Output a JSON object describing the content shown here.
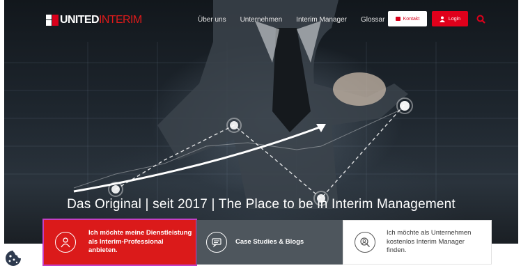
{
  "brand": {
    "logo_part1": "UNITED",
    "logo_part2": "INTERIM",
    "accent": "#d9001b"
  },
  "nav": {
    "items": [
      {
        "label": "Über uns"
      },
      {
        "label": "Unternehmen"
      },
      {
        "label": "Interim Manager"
      },
      {
        "label": "Glossar"
      }
    ],
    "kontakt_label": "Kontakt",
    "login_label": "Login",
    "search_icon": "search-icon"
  },
  "hero": {
    "headline": "Das Original | seit 2017 | The Place to be in Interim Management"
  },
  "cards": [
    {
      "text": "Ich möchte meine Dienstleistung als Interim-Professional anbieten.",
      "icon": "person-icon",
      "color": "#db1a1a"
    },
    {
      "text": "Case Studies & Blogs",
      "icon": "blog-icon",
      "color": "#4e565d"
    },
    {
      "text": "Ich möchte als Unternehmen kostenlos Interim Manager finden.",
      "icon": "search-person-icon",
      "color": "#ffffff"
    }
  ],
  "cookie": {
    "icon": "cookie-icon"
  }
}
